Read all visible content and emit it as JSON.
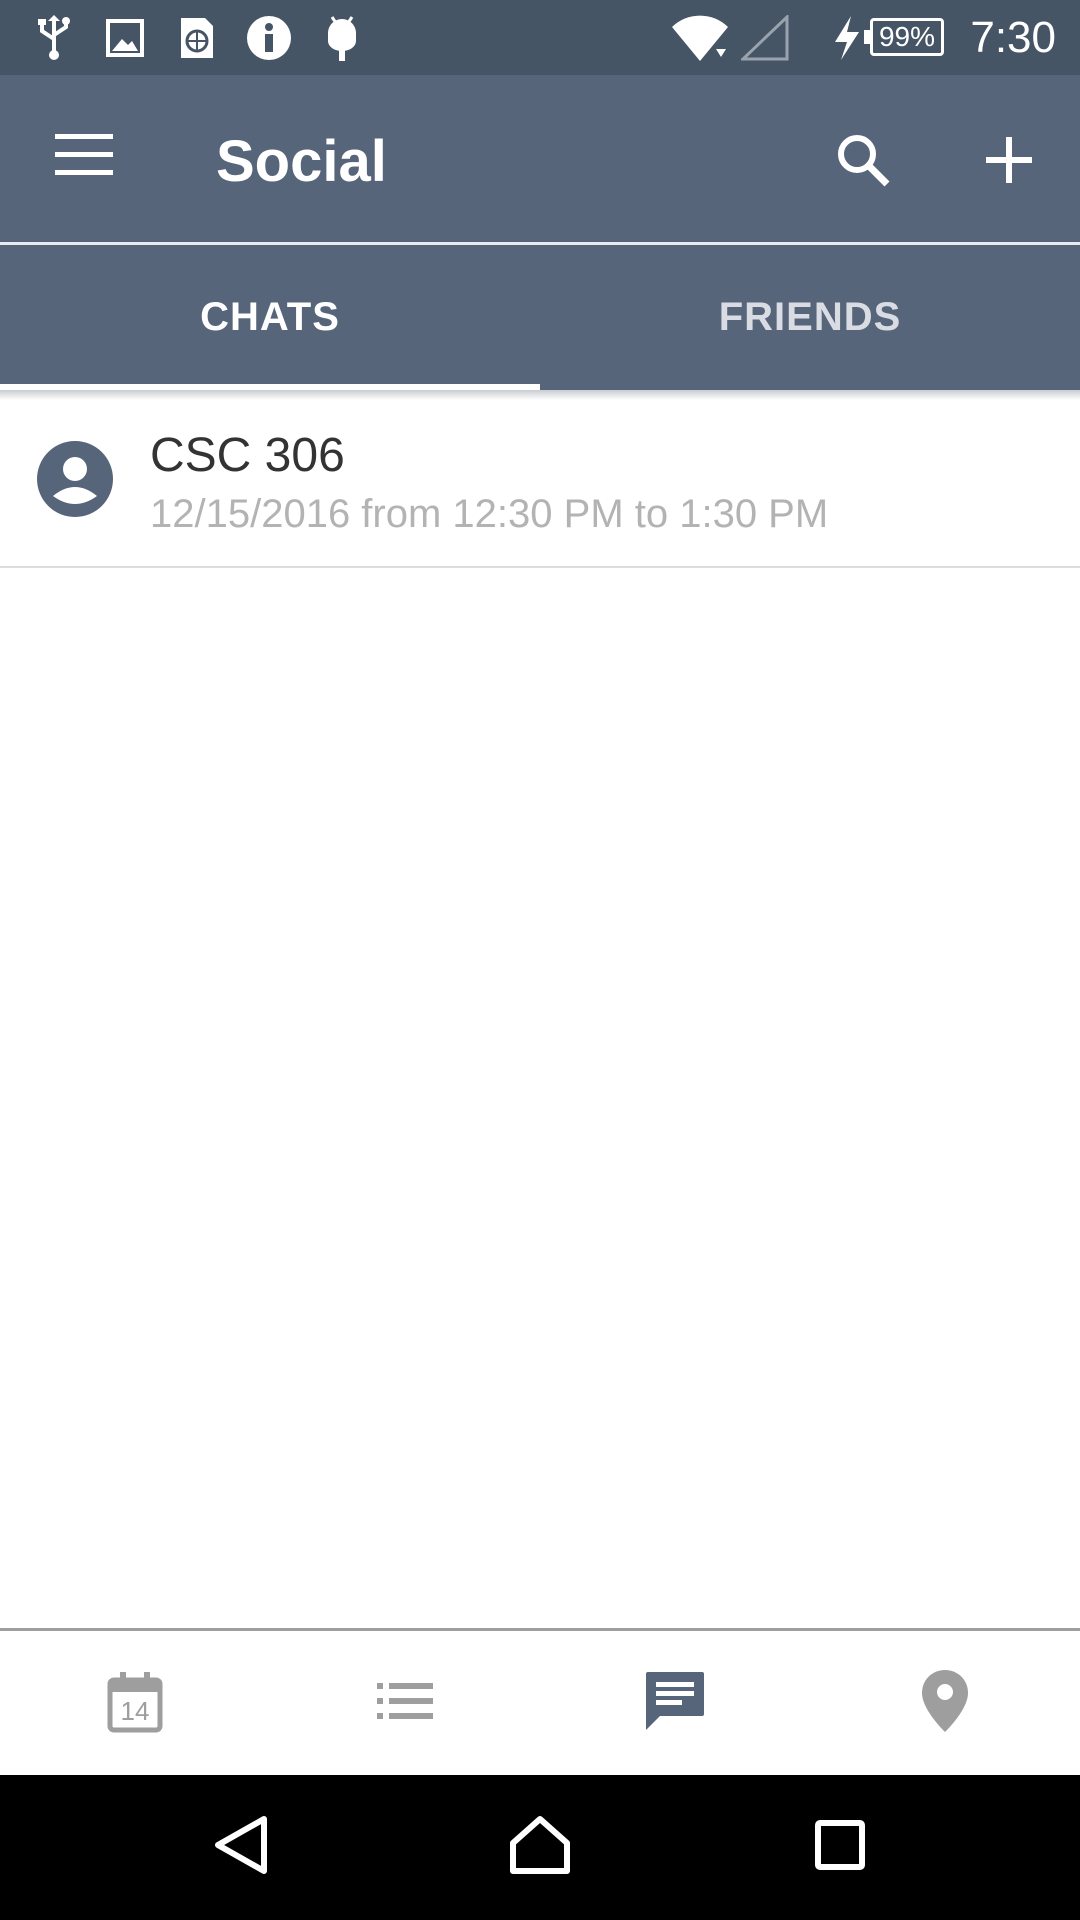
{
  "status_bar": {
    "time": "7:30",
    "battery": "99%",
    "icons": [
      "usb-icon",
      "image-icon",
      "sim-globe-icon",
      "info-icon",
      "android-icon",
      "wifi-icon",
      "signal-icon",
      "charging-icon",
      "battery-icon"
    ]
  },
  "app_bar": {
    "title": "Social",
    "menu_icon": "hamburger-menu-icon",
    "search_icon": "search-icon",
    "add_icon": "plus-icon"
  },
  "tabs": [
    {
      "label": "CHATS",
      "active": true
    },
    {
      "label": "FRIENDS",
      "active": false
    }
  ],
  "chats": [
    {
      "title": "CSC 306",
      "subtitle": "12/15/2016 from 12:30 PM to 1:30 PM",
      "icon": "account-circle-icon"
    }
  ],
  "bottom_nav": {
    "items": [
      {
        "name": "calendar",
        "icon": "calendar-icon",
        "label": "14",
        "active": false
      },
      {
        "name": "list",
        "icon": "list-icon",
        "active": false
      },
      {
        "name": "chat",
        "icon": "chat-icon",
        "active": true
      },
      {
        "name": "location",
        "icon": "location-pin-icon",
        "active": false
      }
    ]
  },
  "colors": {
    "status_bar": "#455565",
    "app_bar": "#56657a",
    "active_nav": "#56657a",
    "inactive_nav": "#9e9e9e"
  }
}
